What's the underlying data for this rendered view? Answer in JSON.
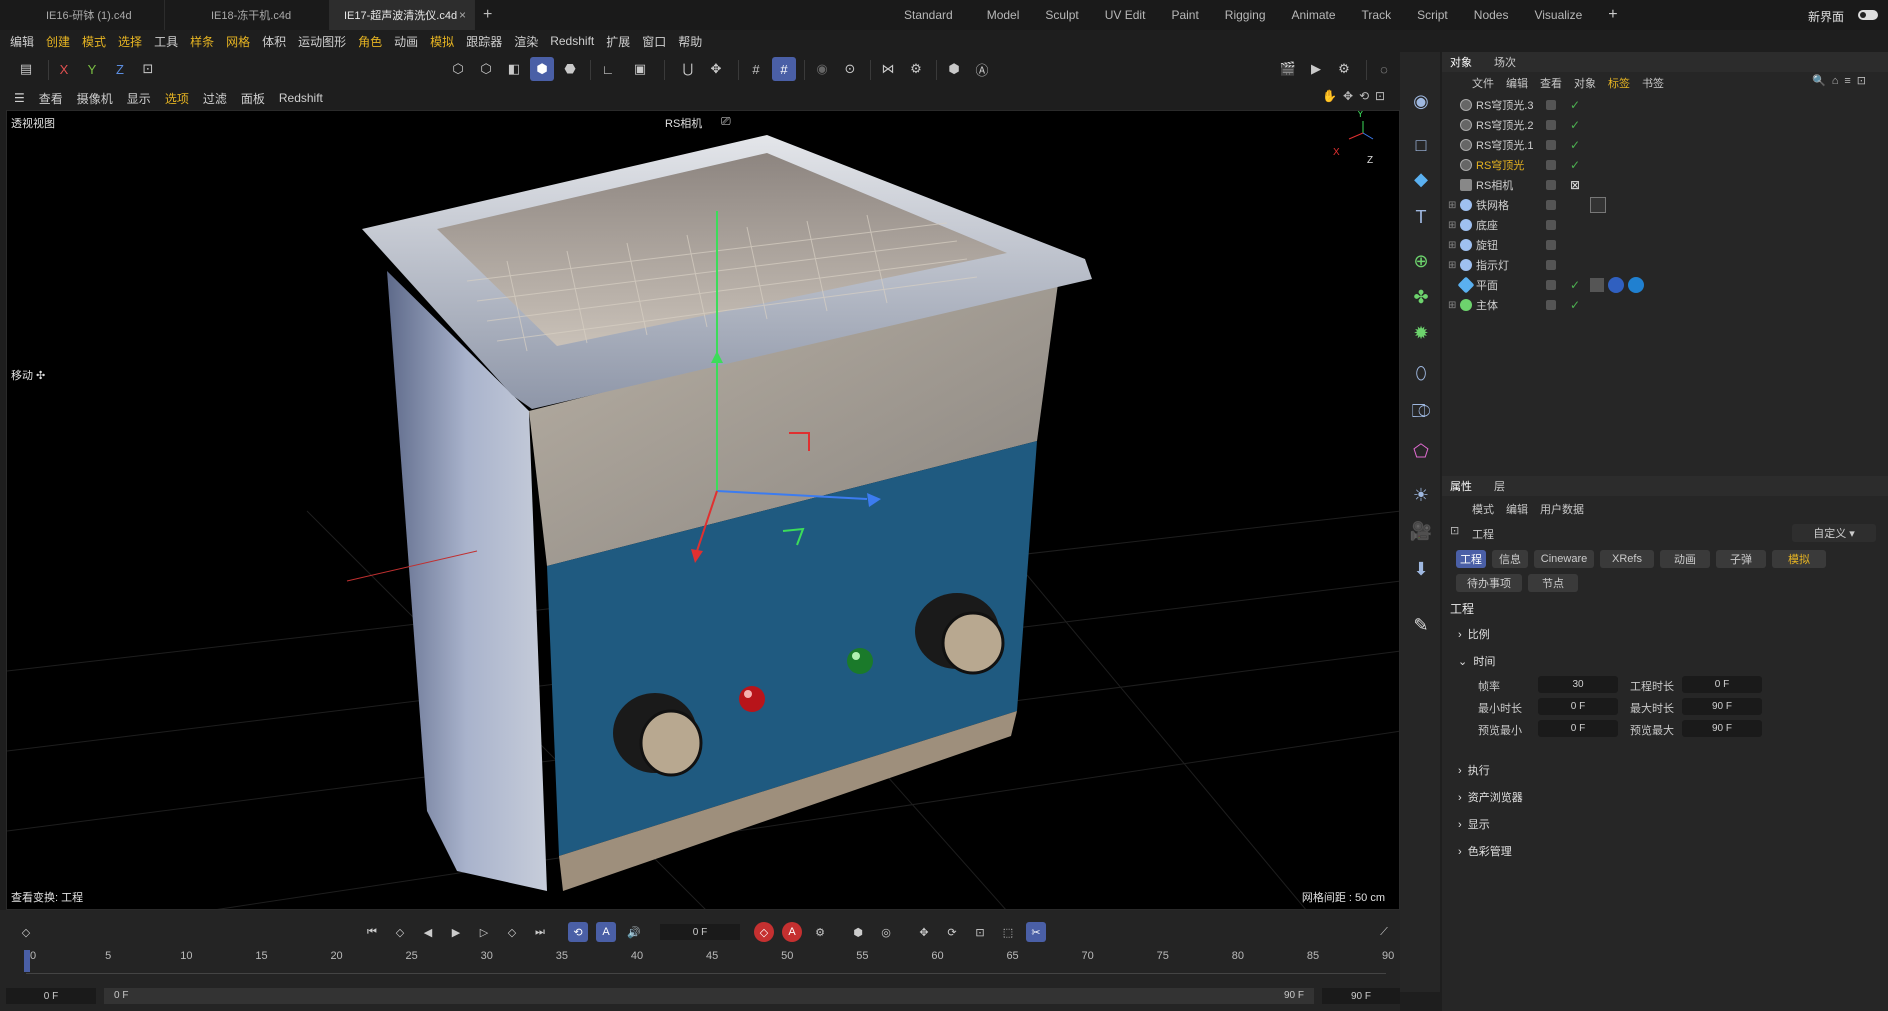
{
  "tabs": [
    {
      "label": "IE16-研钵 (1).c4d"
    },
    {
      "label": "IE18-冻干机.c4d"
    },
    {
      "label": "IE17-超声波清洗仪.c4d"
    }
  ],
  "tab_close": "×",
  "tab_add": "+",
  "layouts": [
    "Standard",
    "Model",
    "Sculpt",
    "UV Edit",
    "Paint",
    "Rigging",
    "Animate",
    "Track",
    "Script",
    "Nodes",
    "Visualize"
  ],
  "layout_plus": "+",
  "new_ui_label": "新界面",
  "menu": [
    "编辑",
    "创建",
    "模式",
    "选择",
    "工具",
    "样条",
    "网格",
    "体积",
    "运动图形",
    "角色",
    "动画",
    "模拟",
    "跟踪器",
    "渲染",
    "Redshift",
    "扩展",
    "窗口",
    "帮助"
  ],
  "toolbar": {
    "x": "X",
    "y": "Y",
    "z": "Z"
  },
  "viewport_menu": [
    "查看",
    "摄像机",
    "显示",
    "选项",
    "过滤",
    "面板",
    "Redshift"
  ],
  "viewport": {
    "name": "透视视图",
    "camera_label": "RS相机",
    "move_label": "移动 ✣",
    "status": "查看变换: 工程",
    "grid_spacing": "网格间距 : 50 cm",
    "axis_y": "Y",
    "axis_x": "X",
    "axis_z": "Z"
  },
  "objects_panel": {
    "tabs": [
      "对象",
      "场次"
    ],
    "menu": [
      "文件",
      "编辑",
      "查看",
      "对象",
      "标签",
      "书签"
    ],
    "items": [
      {
        "name": "RS穹顶光.3",
        "check": "✓"
      },
      {
        "name": "RS穹顶光.2",
        "check": "✓"
      },
      {
        "name": "RS穹顶光.1",
        "check": "✓"
      },
      {
        "name": "RS穹顶光",
        "check": "✓"
      },
      {
        "name": "RS相机",
        "check": ""
      },
      {
        "name": "铁网格",
        "check": ""
      },
      {
        "name": "底座",
        "check": ""
      },
      {
        "name": "旋钮",
        "check": ""
      },
      {
        "name": "指示灯",
        "check": ""
      },
      {
        "name": "平面",
        "check": "✓"
      },
      {
        "name": "主体",
        "check": "✓"
      }
    ]
  },
  "attributes": {
    "tabs": [
      "属性",
      "层"
    ],
    "menu": [
      "模式",
      "编辑",
      "用户数据"
    ],
    "project_label": "工程",
    "preset": "自定义",
    "buttons_row1": [
      "工程",
      "信息",
      "Cineware",
      "XRefs",
      "动画",
      "子弹",
      "模拟"
    ],
    "buttons_row2": [
      "待办事项",
      "节点"
    ],
    "section_title": "工程",
    "sections": [
      "比例",
      "时间",
      "执行",
      "资产浏览器",
      "显示",
      "色彩管理"
    ],
    "time": {
      "fps_label": "帧率",
      "fps": "30",
      "project_len_label": "工程时长",
      "project_len": "0 F",
      "min_label": "最小时长",
      "min": "0 F",
      "max_label": "最大时长",
      "max": "90 F",
      "prev_min_label": "预览最小",
      "prev_min": "0 F",
      "prev_max_label": "预览最大",
      "prev_max": "90 F"
    }
  },
  "timeline": {
    "current_frame": "0 F",
    "ruler": [
      "0",
      "5",
      "10",
      "15",
      "20",
      "25",
      "30",
      "35",
      "40",
      "45",
      "50",
      "55",
      "60",
      "65",
      "70",
      "75",
      "80",
      "85",
      "90"
    ],
    "start": "0 F",
    "range_start": "0 F",
    "range_end": "90 F",
    "end": "90 F"
  }
}
